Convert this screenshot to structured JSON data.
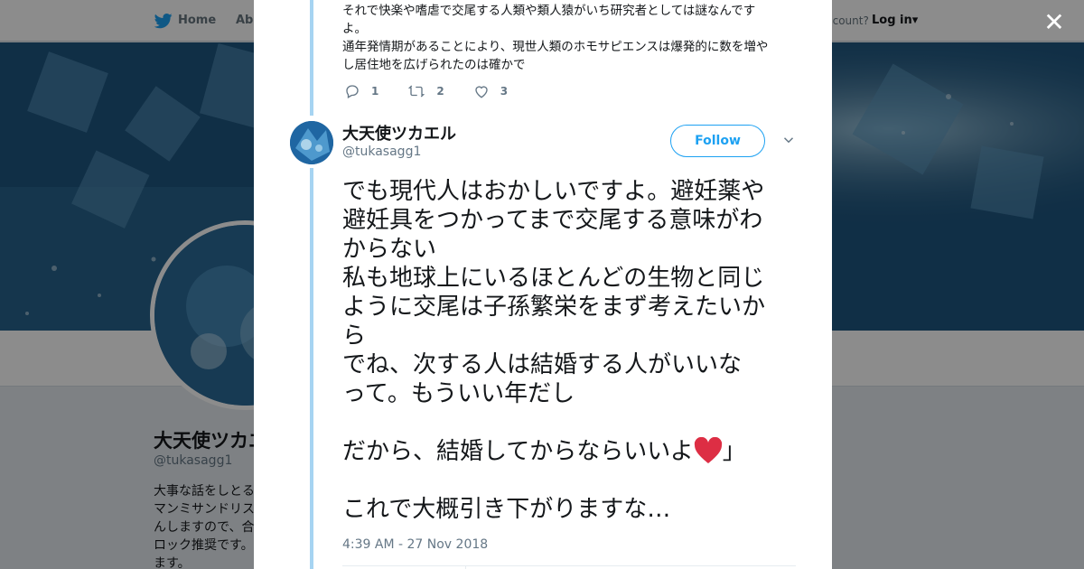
{
  "topbar": {
    "home_label": "Home",
    "about_label": "Abo",
    "account_text": "ccount?",
    "login_label": "Log in"
  },
  "profile": {
    "name": "大天使ツカエ",
    "handle": "@tukasagg1",
    "bio": "大事な話をしとる\nマンミサンドリス\nんしますので、合\nロック推奨です。\nます。"
  },
  "modal": {
    "close_label": "✕",
    "previous_tweet": {
      "text": "それで快楽や嗜虐で交尾する人類や類人猿がいち研究者としては謎なんです\nよ。\n通年発情期があることにより、現世人類のホモサピエンスは爆発的に数を増や\nし居住地を広げられたのは確かで",
      "reply_count": "1",
      "retweet_count": "2",
      "like_count": "3"
    },
    "tweet": {
      "author_name": "大天使ツカエル",
      "author_handle": "@tukasagg1",
      "follow_label": "Follow",
      "text_main": "でも現代人はおかしいですよ。避妊薬や\n避妊具をつかってまで交尾する意味がわ\nからない\n私も地球上にいるほとんどの生物と同じ\nように交尾は子孫繁栄をまず考えたいか\nら\nでね、次する人は結婚する人がいいな\nって。もういい年だし\n\nだから、結婚してからならいいよ",
      "text_quote_end": "」",
      "text_tail": "\n\nこれで大概引き下がりますな…",
      "timestamp": "4:39 AM - 27 Nov 2018"
    }
  },
  "colors": {
    "accent": "#1da1f2",
    "thread_line": "#a6d4f2",
    "heart": "#e0245e"
  },
  "icons": [
    "twitter-bird-icon",
    "reply-icon",
    "retweet-icon",
    "like-icon",
    "chevron-down-icon",
    "close-icon",
    "red-heart-emoji"
  ]
}
